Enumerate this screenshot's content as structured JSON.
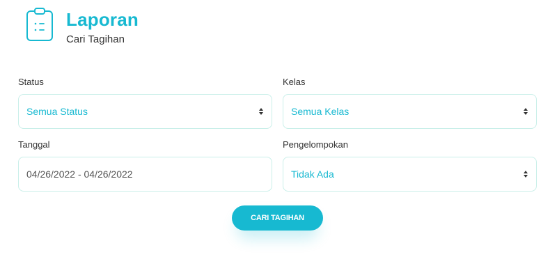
{
  "header": {
    "icon": "clipboard-list-icon",
    "title": "Laporan",
    "subtitle": "Cari Tagihan"
  },
  "form": {
    "status": {
      "label": "Status",
      "value": "Semua Status"
    },
    "kelas": {
      "label": "Kelas",
      "value": "Semua Kelas"
    },
    "tanggal": {
      "label": "Tanggal",
      "value": "04/26/2022 - 04/26/2022"
    },
    "pengelompokan": {
      "label": "Pengelompokan",
      "value": "Tidak Ada"
    }
  },
  "actions": {
    "search_label": "CARI TAGIHAN"
  },
  "colors": {
    "accent": "#17b9d1",
    "border": "#c9efe9"
  }
}
